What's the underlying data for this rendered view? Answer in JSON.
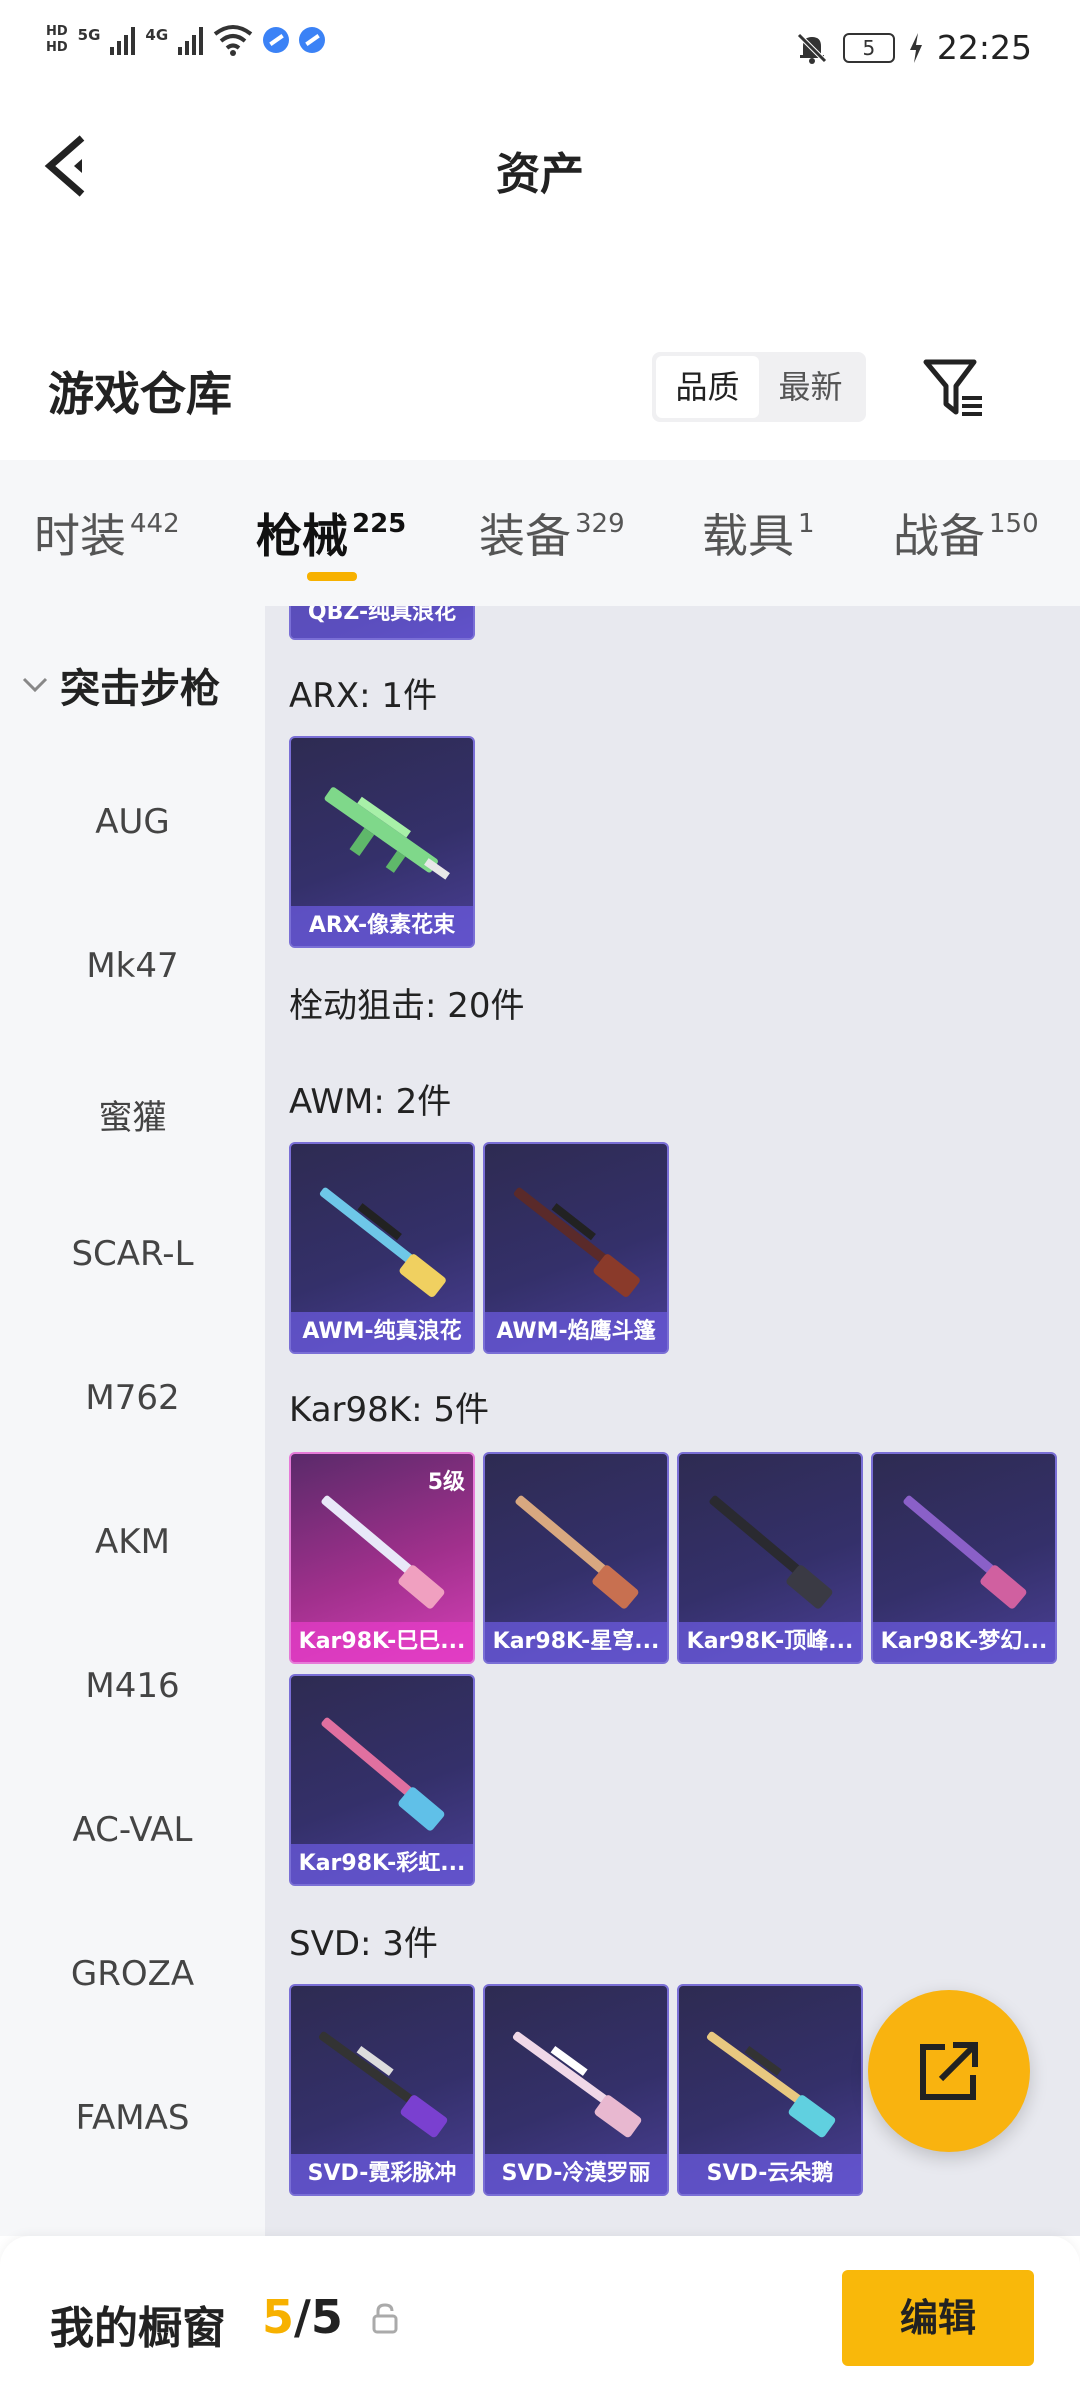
{
  "status_bar": {
    "hd1": "HD",
    "hd2": "HD",
    "net1": "5G",
    "net2": "4G",
    "battery": "5",
    "time": "22:25"
  },
  "nav": {
    "title": "资产"
  },
  "warehouse": {
    "title": "游戏仓库",
    "sort_options": [
      "品质",
      "最新"
    ],
    "active_sort": "品质"
  },
  "tabs": [
    {
      "label": "时装",
      "count": "442"
    },
    {
      "label": "枪械",
      "count": "225"
    },
    {
      "label": "装备",
      "count": "329"
    },
    {
      "label": "载具",
      "count": "1"
    },
    {
      "label": "战备",
      "count": "150"
    }
  ],
  "active_tab": "枪械",
  "sidebar": {
    "category": "突击步枪",
    "items": [
      "AUG",
      "Mk47",
      "蜜獾",
      "SCAR-L",
      "M762",
      "AKM",
      "M416",
      "AC-VAL",
      "GROZA",
      "FAMAS"
    ]
  },
  "content": {
    "peek_card": "QBZ-纯真浪花",
    "groups": [
      {
        "label": "ARX: 1件",
        "items": [
          {
            "name": "ARX-像素花束"
          }
        ]
      },
      {
        "label": "栓动狙击: 20件"
      },
      {
        "label": "AWM: 2件",
        "items": [
          {
            "name": "AWM-纯真浪花"
          },
          {
            "name": "AWM-焰鹰斗篷"
          }
        ]
      },
      {
        "label": "Kar98K: 5件",
        "items": [
          {
            "name": "Kar98K-巳巳...",
            "badge": "5级",
            "rarity": "pink"
          },
          {
            "name": "Kar98K-星穹..."
          },
          {
            "name": "Kar98K-顶峰..."
          },
          {
            "name": "Kar98K-梦幻..."
          },
          {
            "name": "Kar98K-彩虹..."
          }
        ]
      },
      {
        "label": "SVD: 3件",
        "items": [
          {
            "name": "SVD-霓彩脉冲"
          },
          {
            "name": "SVD-冷漠罗丽"
          },
          {
            "name": "SVD-云朵鹅"
          }
        ]
      }
    ]
  },
  "bottom_bar": {
    "title": "我的橱窗",
    "count_current": "5",
    "count_sep": "/",
    "count_total": "5",
    "edit_label": "编辑"
  },
  "colors": {
    "accent": "#f9b80a",
    "card_purple": "#34306a",
    "card_pink": "#d640b8"
  }
}
